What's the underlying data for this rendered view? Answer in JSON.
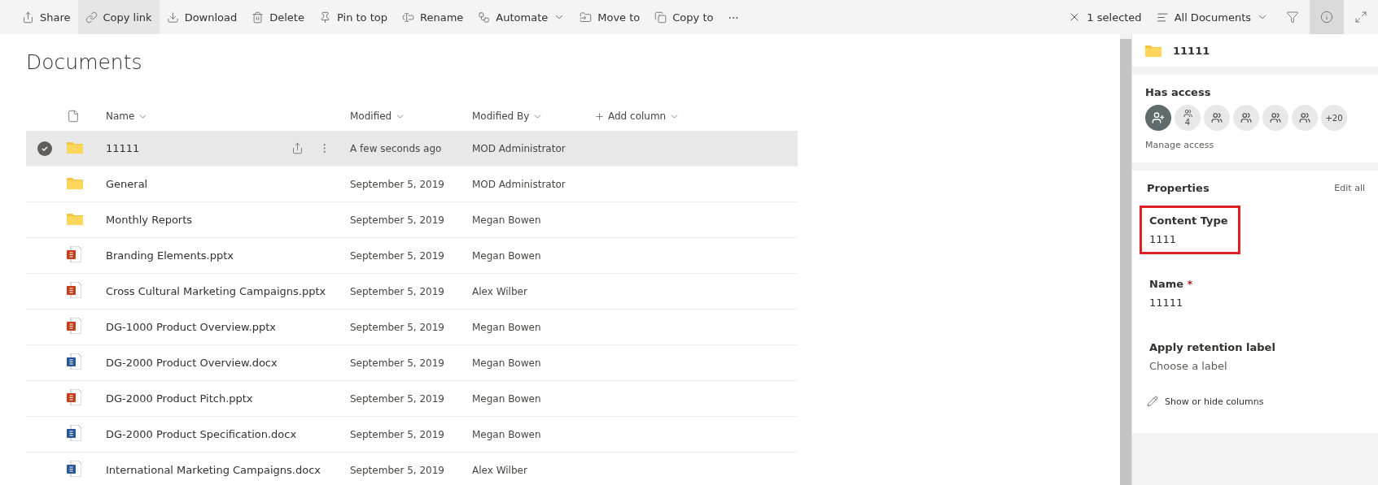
{
  "toolbar": {
    "commands": [
      {
        "kind": "share",
        "label": "Share",
        "selected": false
      },
      {
        "kind": "link",
        "label": "Copy link",
        "selected": true
      },
      {
        "kind": "download",
        "label": "Download",
        "selected": false
      },
      {
        "kind": "delete",
        "label": "Delete",
        "selected": false
      },
      {
        "kind": "pin",
        "label": "Pin to top",
        "selected": false
      },
      {
        "kind": "rename",
        "label": "Rename",
        "selected": false
      },
      {
        "kind": "automate",
        "label": "Automate",
        "selected": false
      },
      {
        "kind": "move",
        "label": "Move to",
        "selected": false
      },
      {
        "kind": "copy",
        "label": "Copy to",
        "selected": false
      },
      {
        "kind": "more",
        "label": "⋯",
        "selected": false
      }
    ],
    "selection": "1 selected",
    "view": "All Documents",
    "info_open": true
  },
  "page_title": "Documents",
  "table": {
    "columns": [
      "Name",
      "Modified",
      "Modified By",
      "Add column"
    ],
    "rows": [
      {
        "kind": "folder",
        "name": "11111",
        "modified": "A few seconds ago",
        "modified_by": "MOD Administrator",
        "selected": true
      },
      {
        "kind": "folder",
        "name": "General",
        "modified": "September 5, 2019",
        "modified_by": "MOD Administrator",
        "selected": false
      },
      {
        "kind": "folder",
        "name": "Monthly Reports",
        "modified": "September 5, 2019",
        "modified_by": "Megan Bowen",
        "selected": false
      },
      {
        "kind": "pptx",
        "name": "Branding Elements.pptx",
        "modified": "September 5, 2019",
        "modified_by": "Megan Bowen",
        "selected": false
      },
      {
        "kind": "pptx",
        "name": "Cross Cultural Marketing Campaigns.pptx",
        "modified": "September 5, 2019",
        "modified_by": "Alex Wilber",
        "selected": false
      },
      {
        "kind": "pptx",
        "name": "DG-1000 Product Overview.pptx",
        "modified": "September 5, 2019",
        "modified_by": "Megan Bowen",
        "selected": false
      },
      {
        "kind": "docx",
        "name": "DG-2000 Product Overview.docx",
        "modified": "September 5, 2019",
        "modified_by": "Megan Bowen",
        "selected": false
      },
      {
        "kind": "pptx",
        "name": "DG-2000 Product Pitch.pptx",
        "modified": "September 5, 2019",
        "modified_by": "Megan Bowen",
        "selected": false
      },
      {
        "kind": "docx",
        "name": "DG-2000 Product Specification.docx",
        "modified": "September 5, 2019",
        "modified_by": "Megan Bowen",
        "selected": false
      },
      {
        "kind": "docx",
        "name": "International Marketing Campaigns.docx",
        "modified": "September 5, 2019",
        "modified_by": "Alex Wilber",
        "selected": false
      }
    ]
  },
  "details": {
    "title": "11111",
    "access": {
      "heading": "Has access",
      "people": [
        {
          "kind": "add"
        },
        {
          "kind": "group",
          "count": "4"
        },
        {
          "kind": "person"
        },
        {
          "kind": "person"
        },
        {
          "kind": "person"
        },
        {
          "kind": "person"
        },
        {
          "kind": "more",
          "label": "+20"
        }
      ],
      "link": "Manage access"
    },
    "properties": {
      "heading": "Properties",
      "edit": "Edit all",
      "fields": [
        {
          "label": "Content Type",
          "value": "1111",
          "highlighted": true,
          "placeholder": false
        },
        {
          "label": "Name",
          "required_mark": "*",
          "value": "11111",
          "highlighted": false,
          "placeholder": false
        },
        {
          "label": "Apply retention label",
          "value": "Choose a label",
          "highlighted": false,
          "placeholder": true
        }
      ],
      "columns_link": "Show or hide columns"
    }
  }
}
